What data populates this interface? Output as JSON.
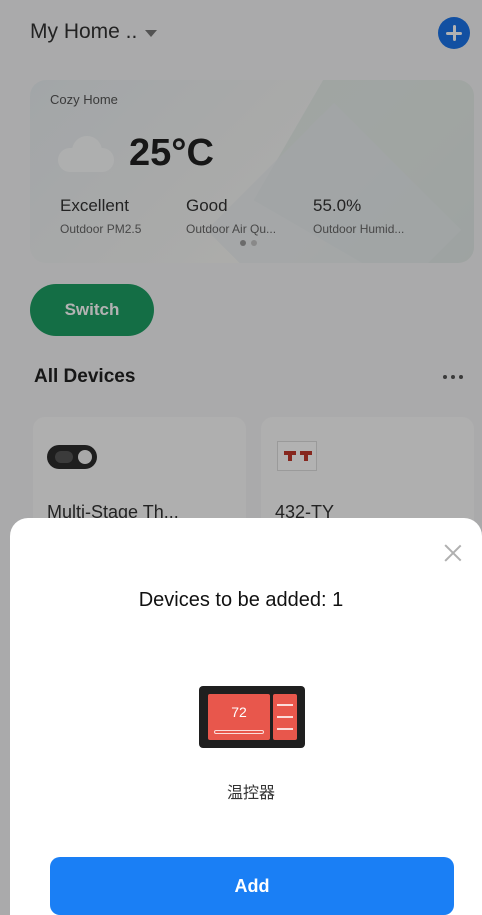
{
  "header": {
    "home_title": "My Home .."
  },
  "weather": {
    "label": "Cozy Home",
    "temperature": "25°C",
    "metrics": [
      {
        "value": "Excellent",
        "label": "Outdoor PM2.5"
      },
      {
        "value": "Good",
        "label": "Outdoor Air Qu..."
      },
      {
        "value": "55.0%",
        "label": "Outdoor Humid..."
      }
    ]
  },
  "switch_label": "Switch",
  "devices_section": {
    "title": "All Devices"
  },
  "devices": [
    {
      "name": "Multi-Stage Th...",
      "icon": "thermostat-icon"
    },
    {
      "name": "432-TY",
      "icon": "ty-device-icon"
    }
  ],
  "sheet": {
    "title": "Devices to be added: 1",
    "device_screen_value": "72",
    "device_label": "温控器",
    "add_label": "Add"
  },
  "colors": {
    "accent": "#1a7ff5",
    "switch_green": "#1e9e63"
  }
}
